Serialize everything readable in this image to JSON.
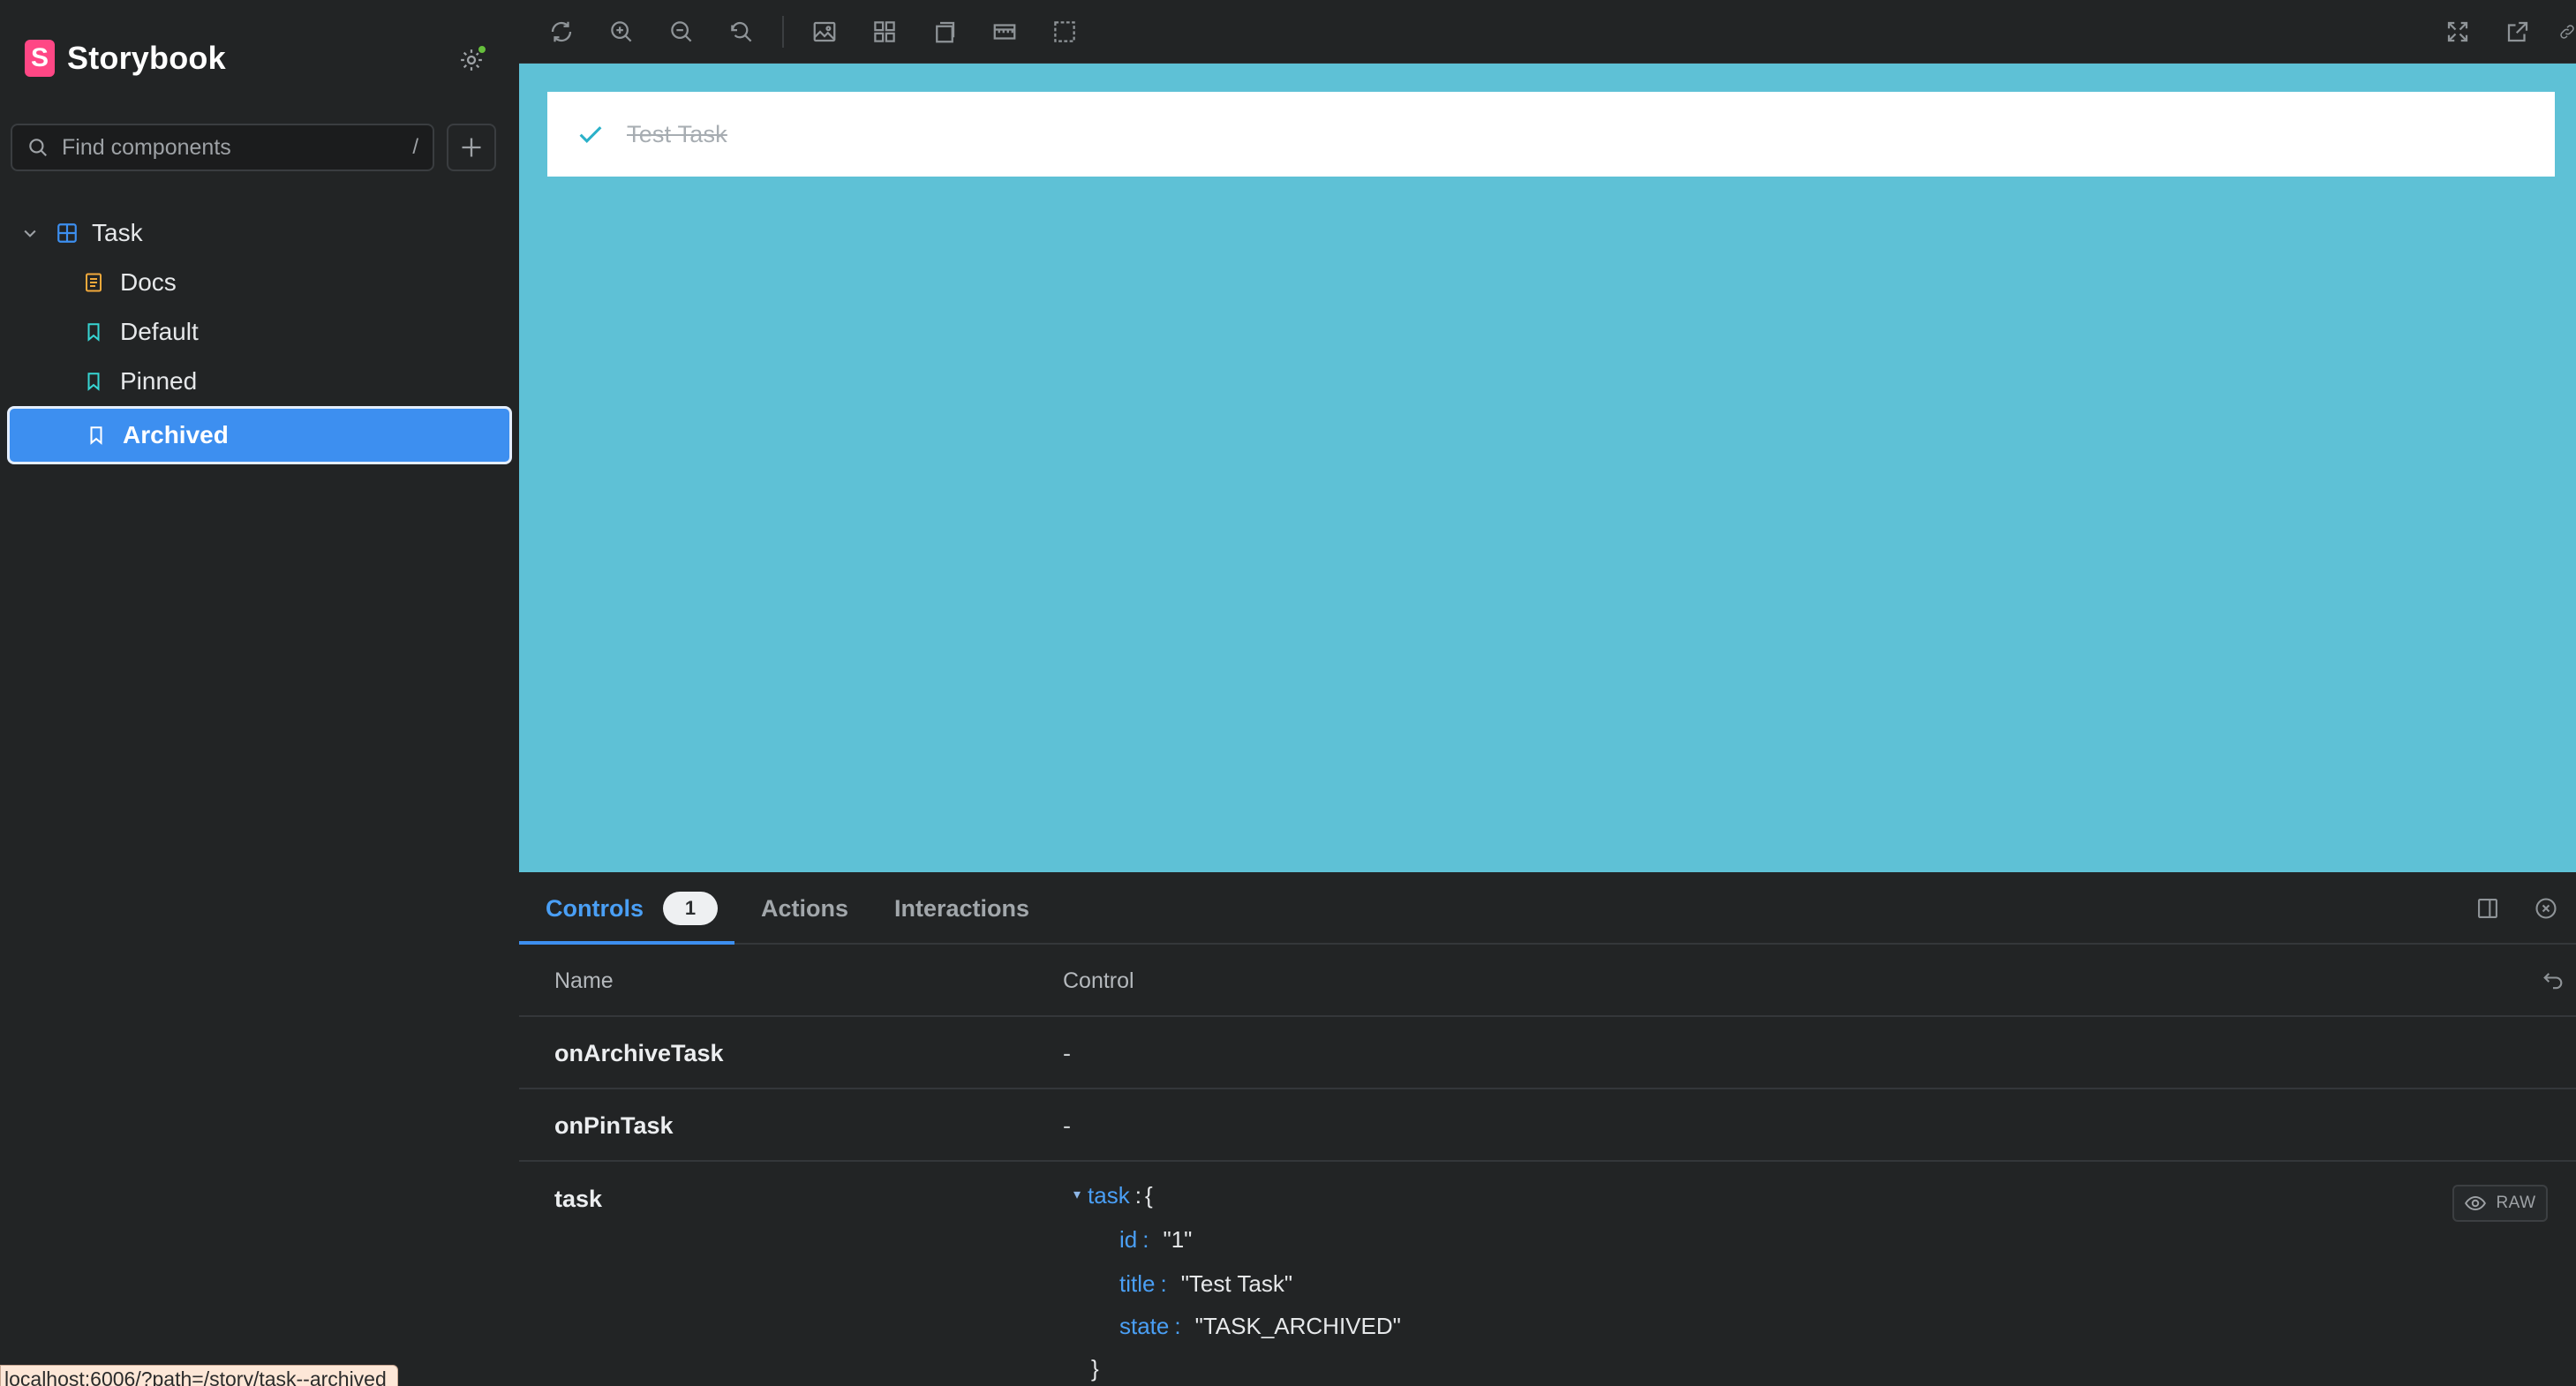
{
  "sidebar": {
    "brand_logo_letter": "S",
    "brand_name": "Storybook",
    "search": {
      "placeholder": "Find components",
      "shortcut": "/"
    },
    "tree": {
      "group_label": "Task",
      "items": [
        {
          "label": "Docs",
          "icon": "document-icon"
        },
        {
          "label": "Default",
          "icon": "bookmark-icon"
        },
        {
          "label": "Pinned",
          "icon": "bookmark-icon"
        },
        {
          "label": "Archived",
          "icon": "bookmark-icon",
          "selected": true
        }
      ]
    }
  },
  "status_url": "localhost:6006/?path=/story/task--archived",
  "canvas": {
    "background": "#5ec1d6",
    "task_title": "Test Task"
  },
  "panel": {
    "tabs": [
      {
        "label": "Controls",
        "badge": "1",
        "active": true
      },
      {
        "label": "Actions"
      },
      {
        "label": "Interactions"
      }
    ],
    "table": {
      "name_header": "Name",
      "control_header": "Control",
      "rows": [
        {
          "name": "onArchiveTask",
          "control": "-"
        },
        {
          "name": "onPinTask",
          "control": "-"
        },
        {
          "name": "task"
        }
      ]
    },
    "task_object": {
      "root_key": "task",
      "open_brace": "{",
      "close_brace": "}",
      "fields": [
        {
          "key": "id",
          "value": "\"1\""
        },
        {
          "key": "title",
          "value": "\"Test Task\""
        },
        {
          "key": "state",
          "value": "\"TASK_ARCHIVED\""
        }
      ],
      "raw_label": "RAW"
    }
  },
  "colors": {
    "accent": "#3d8ff0",
    "brand": "#ff4785",
    "canvas_bg": "#5ec1d6",
    "status_ok": "#66bf3c"
  }
}
